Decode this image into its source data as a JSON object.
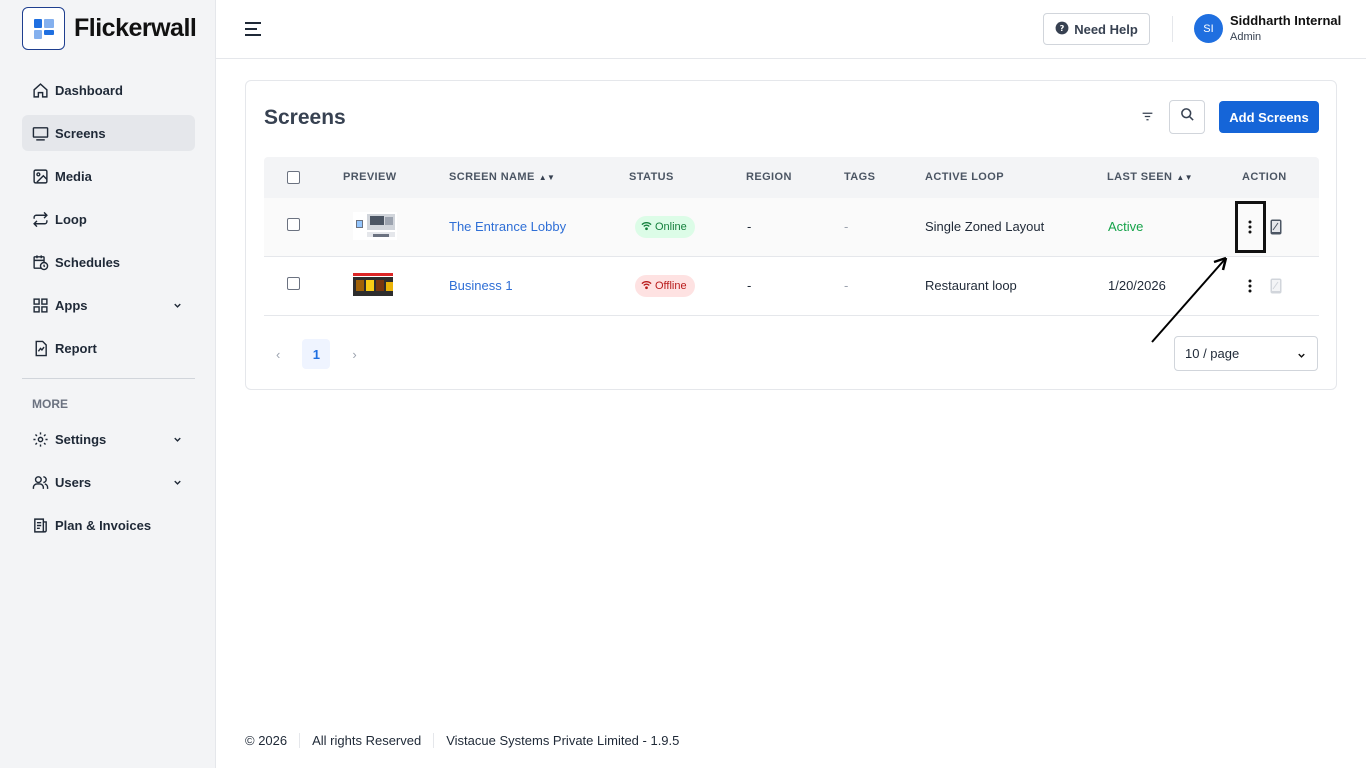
{
  "brand": {
    "name": "Flickerwall",
    "accent": "#1565d8"
  },
  "sidebar": {
    "items": [
      {
        "label": "Dashboard",
        "icon": "home-icon"
      },
      {
        "label": "Screens",
        "icon": "monitor-icon",
        "active": true
      },
      {
        "label": "Media",
        "icon": "image-icon"
      },
      {
        "label": "Loop",
        "icon": "loop-icon"
      },
      {
        "label": "Schedules",
        "icon": "calendar-clock-icon"
      },
      {
        "label": "Apps",
        "icon": "apps-grid-icon",
        "expandable": true
      },
      {
        "label": "Report",
        "icon": "report-icon"
      }
    ],
    "more_label": "MORE",
    "more_items": [
      {
        "label": "Settings",
        "icon": "gear-icon",
        "expandable": true
      },
      {
        "label": "Users",
        "icon": "users-icon",
        "expandable": true
      },
      {
        "label": "Plan & Invoices",
        "icon": "invoice-icon"
      }
    ]
  },
  "header": {
    "help_label": "Need Help",
    "user": {
      "initials": "SI",
      "name": "Siddharth Internal",
      "role": "Admin"
    }
  },
  "screens": {
    "title": "Screens",
    "add_label": "Add Screens",
    "columns": [
      "PREVIEW",
      "SCREEN NAME",
      "STATUS",
      "REGION",
      "TAGS",
      "ACTIVE LOOP",
      "LAST SEEN",
      "ACTION"
    ],
    "rows": [
      {
        "name": "The Entrance Lobby",
        "status": "Online",
        "region": "-",
        "tags": "-",
        "loop": "Single Zoned Layout",
        "last_seen": "Active"
      },
      {
        "name": "Business 1",
        "status": "Offline",
        "region": "-",
        "tags": "-",
        "loop": "Restaurant loop",
        "last_seen": "1/20/2026"
      }
    ],
    "pagination": {
      "prev": "‹",
      "current": "1",
      "next": "›",
      "page_size": "10 / page"
    }
  },
  "footer": {
    "copyright": "© 2026",
    "rights": "All rights Reserved",
    "company": "Vistacue Systems Private Limited - 1.9.5"
  }
}
